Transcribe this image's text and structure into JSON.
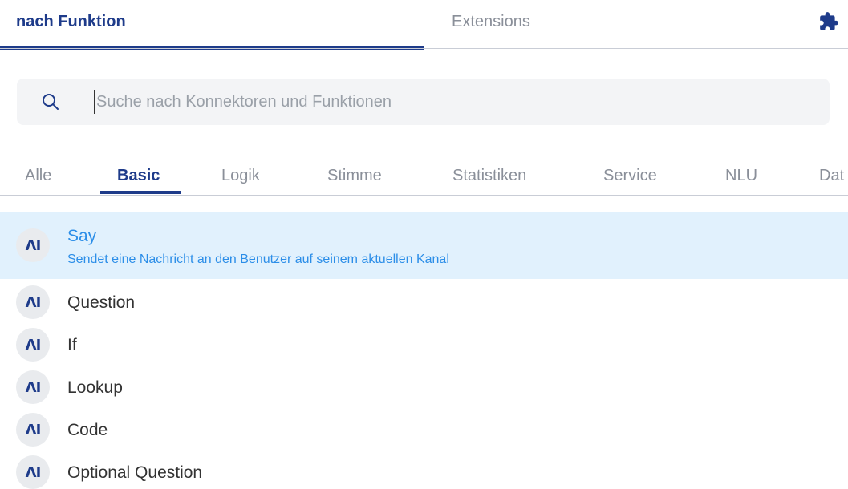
{
  "top_tabs": {
    "function_label": "nach Funktion",
    "extensions_label": "Extensions",
    "extensions_icon": "puzzle-icon"
  },
  "search": {
    "placeholder": "Suche nach Konnektoren und Funktionen",
    "value": ""
  },
  "categories": [
    "Alle",
    "Basic",
    "Logik",
    "Stimme",
    "Statistiken",
    "Service",
    "NLU",
    "Dat"
  ],
  "active_category": "Basic",
  "items": [
    {
      "avatar": "ΛI",
      "title": "Say",
      "description": "Sendet eine Nachricht an den Benutzer auf seinem aktuellen Kanal"
    },
    {
      "avatar": "ΛI",
      "title": "Question"
    },
    {
      "avatar": "ΛI",
      "title": "If"
    },
    {
      "avatar": "ΛI",
      "title": "Lookup"
    },
    {
      "avatar": "ΛI",
      "title": "Code"
    },
    {
      "avatar": "ΛI",
      "title": "Optional Question"
    }
  ],
  "colors": {
    "accent_navy": "#1e3b8a",
    "highlight_bg": "#e1f1fd",
    "highlight_text": "#2c8ee8"
  }
}
